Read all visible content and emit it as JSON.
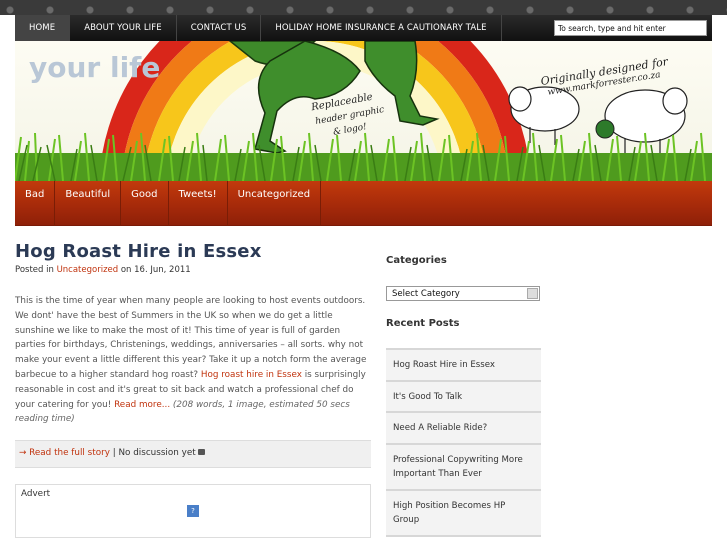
{
  "nav": {
    "items": [
      {
        "label": "HOME"
      },
      {
        "label": "ABOUT YOUR LIFE"
      },
      {
        "label": "CONTACT US"
      },
      {
        "label": "HOLIDAY HOME INSURANCE A CAUTIONARY TALE"
      }
    ],
    "search_placeholder": "To search, type and hit enter"
  },
  "header": {
    "logo": "your life",
    "note_line1": "Originally designed for",
    "note_line2": "www.markforrester.co.za",
    "replace_line1": "Replaceable",
    "replace_line2": "header graphic",
    "replace_line3": "& logo!"
  },
  "categories_bar": [
    "Bad",
    "Beautiful",
    "Good",
    "Tweets!",
    "Uncategorized"
  ],
  "post": {
    "title": "Hog Roast Hire in Essex",
    "meta_prefix": "Posted in ",
    "meta_category": "Uncategorized",
    "meta_date": " on 16. Jun, 2011",
    "body_part1": "This is the time of year when many people are looking to host events outdoors. We dont' have the best of Summers in the UK so when we do get a little sunshine we like to make the most of it! This time of year is full of garden parties for birthdays, Christenings, weddings, anniversaries – all sorts. why not make your event a little different this year? Take it up a notch form the average barbecue to a higher standard hog roast? ",
    "body_link": "Hog roast hire in Essex",
    "body_part2": " is surprisingly reasonable in cost and it's great to sit back and watch a professional chef do your catering for you!  ",
    "read_more": "Read more...",
    "stats": " (208 words, 1 image, estimated 50 secs reading time)",
    "read_full": "→ Read the full story",
    "discussion": " | No discussion yet "
  },
  "advert": {
    "label": "Advert",
    "icon": "?"
  },
  "sidebar": {
    "categories_title": "Categories",
    "select_value": "Select Category",
    "recent_title": "Recent Posts",
    "recent": [
      "Hog Roast Hire in Essex",
      "It's Good To Talk",
      "Need A Reliable Ride?",
      "Professional Copywriting More Important Than Ever",
      "High Position Becomes HP Group"
    ]
  }
}
